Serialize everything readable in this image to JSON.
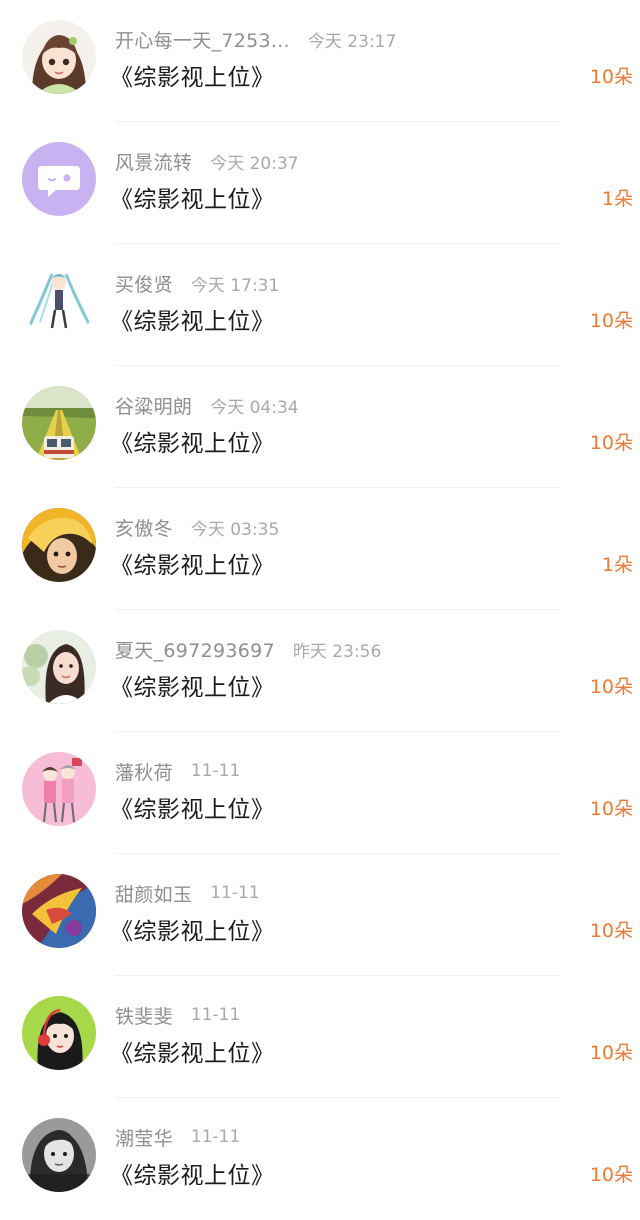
{
  "colors": {
    "accent": "#ef7a31",
    "name_text": "#8f8f8f",
    "time_text": "#a9a9a9",
    "title_text": "#1b1b1b"
  },
  "items": [
    {
      "name": "开心每一天_7253...",
      "time": "今天 23:17",
      "title": "《综影视上位》",
      "count": "10朵",
      "avatar_icon": "anime-girl-avatar"
    },
    {
      "name": "风景流转",
      "time": "今天 20:37",
      "title": "《综影视上位》",
      "count": "1朵",
      "avatar_icon": "default-chat-bubble-avatar"
    },
    {
      "name": "买俊贤",
      "time": "今天 17:31",
      "title": "《综影视上位》",
      "count": "10朵",
      "avatar_icon": "anime-figure-avatar"
    },
    {
      "name": "谷粱明朗",
      "time": "今天 04:34",
      "title": "《综影视上位》",
      "count": "10朵",
      "avatar_icon": "train-landscape-avatar"
    },
    {
      "name": "亥傲冬",
      "time": "今天 03:35",
      "title": "《综影视上位》",
      "count": "1朵",
      "avatar_icon": "blonde-portrait-avatar"
    },
    {
      "name": "夏天_697293697",
      "time": "昨天 23:56",
      "title": "《综影视上位》",
      "count": "10朵",
      "avatar_icon": "woman-photo-avatar"
    },
    {
      "name": "藩秋荷",
      "time": "11-11",
      "title": "《综影视上位》",
      "count": "10朵",
      "avatar_icon": "pink-cartoon-couple-avatar"
    },
    {
      "name": "甜颜如玉",
      "time": "11-11",
      "title": "《综影视上位》",
      "count": "10朵",
      "avatar_icon": "colorful-painting-avatar"
    },
    {
      "name": "铁斐斐",
      "time": "11-11",
      "title": "《综影视上位》",
      "count": "10朵",
      "avatar_icon": "headphone-girl-avatar"
    },
    {
      "name": "潮莹华",
      "time": "11-11",
      "title": "《综影视上位》",
      "count": "10朵",
      "avatar_icon": "bw-girl-avatar"
    }
  ]
}
